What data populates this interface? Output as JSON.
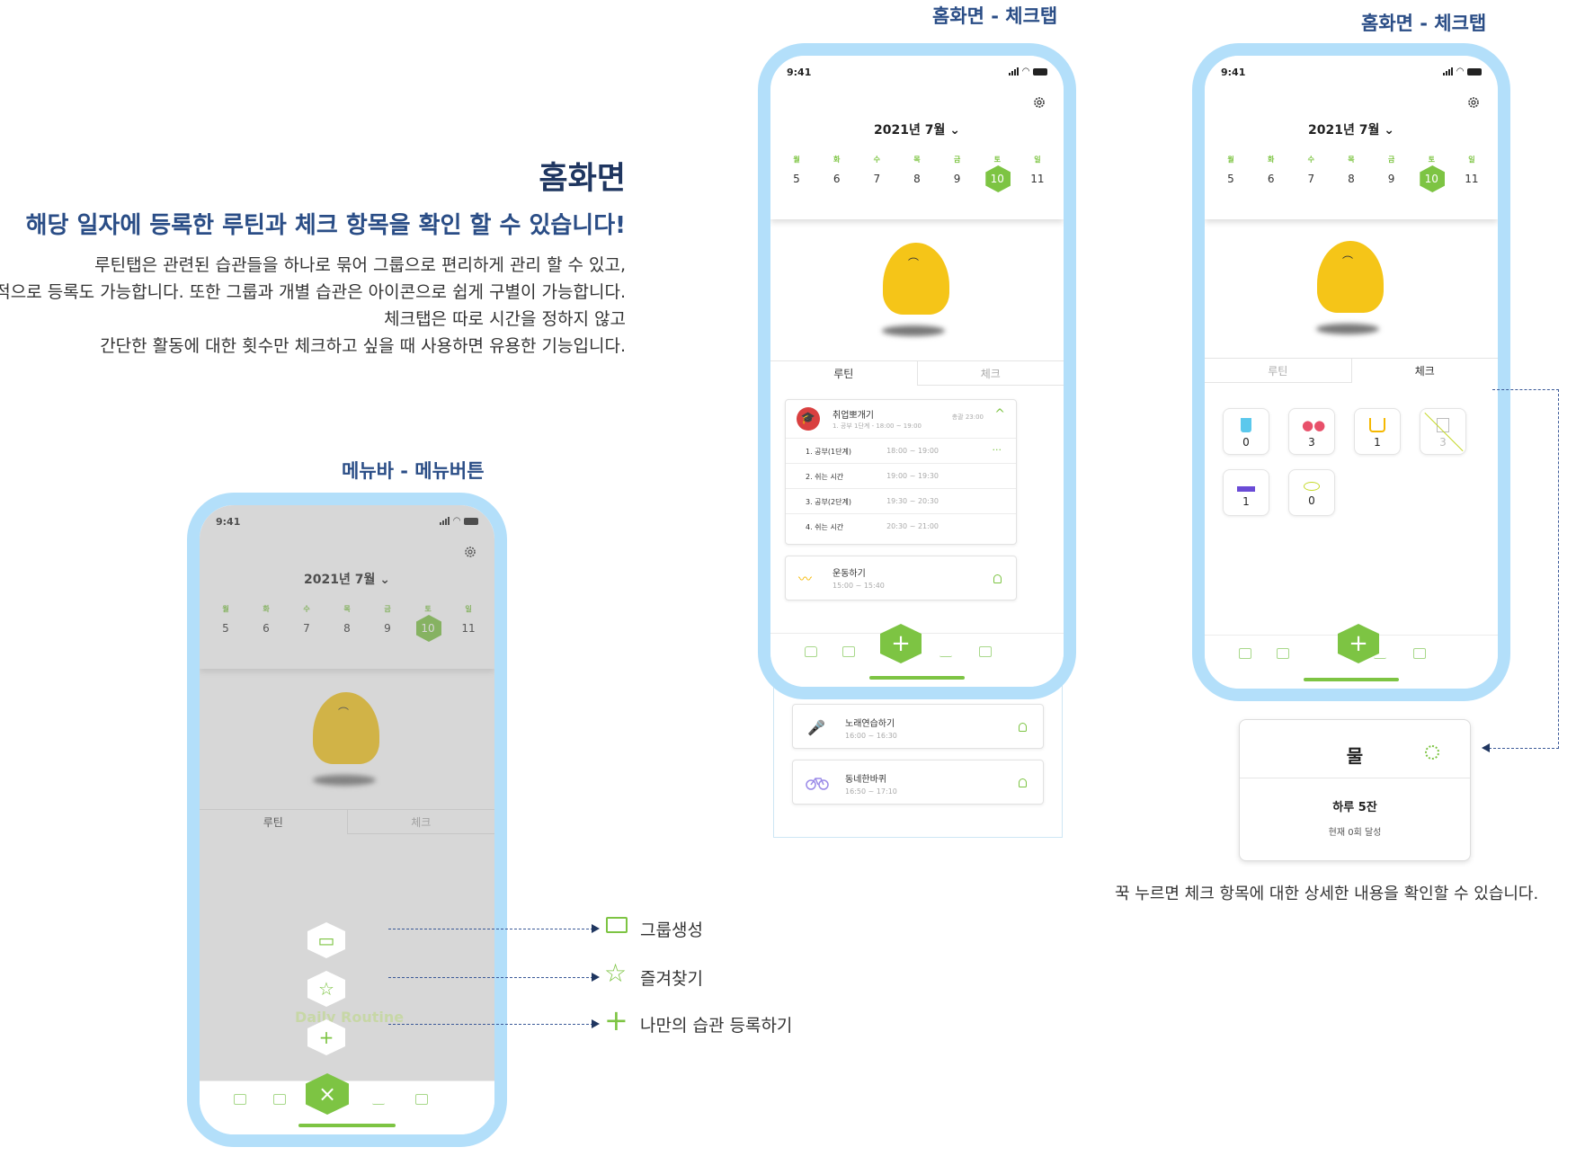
{
  "description": {
    "title": "홈화면",
    "subtitle": "해당 일자에 등록한 루틴과 체크 항목을 확인 할 수 있습니다!",
    "lines": [
      "루틴탭은 관련된 습관들을 하나로 묶어 그룹으로 편리하게 관리 할 수 있고,",
      "개별적으로 등록도 가능합니다. 또한 그룹과 개별 습관은 아이콘으로 쉽게 구별이 가능합니다.",
      "체크탭은 따로 시간을 정하지 않고",
      "간단한 활동에 대한 횟수만 체크하고 싶을 때 사용하면 유용한 기능입니다."
    ]
  },
  "captions": {
    "menu": "메뉴바 - 메뉴버튼",
    "home_routine": "홈화면 - 체크탭",
    "home_check": "홈화면 - 체크탭"
  },
  "phone": {
    "time": "9:41",
    "month": "2021년 7월",
    "weekdays": [
      "월",
      "화",
      "수",
      "목",
      "금",
      "토",
      "일"
    ],
    "dates": [
      "5",
      "6",
      "7",
      "8",
      "9",
      "10",
      "11"
    ],
    "selected_date": "10",
    "tabs": {
      "routine": "루틴",
      "check": "체크"
    },
    "fab_plus": "+",
    "fab_close": "×"
  },
  "routine_tab": {
    "group": {
      "title": "취업뽀개기",
      "subtitle": "1. 공부 1단계 - 18:00 ~ 19:00",
      "right": "총괄 23:00",
      "icon": "graduation-cap-icon"
    },
    "steps": [
      {
        "name": "1. 공부(1단계)",
        "time": "18:00 ~ 19:00"
      },
      {
        "name": "2. 쉬는 시간",
        "time": "19:00 ~ 19:30"
      },
      {
        "name": "3. 공부(2단계)",
        "time": "19:30 ~ 20:30"
      },
      {
        "name": "4. 쉬는 시간",
        "time": "20:30 ~ 21:00"
      }
    ],
    "more": "···",
    "habits": [
      {
        "title": "운동하기",
        "time": "15:00 ~ 15:40",
        "icon": "swim-icon"
      },
      {
        "title": "노래연습하기",
        "time": "16:00 ~ 16:30",
        "icon": "microphone-icon"
      },
      {
        "title": "동네한바퀴",
        "time": "16:50 ~ 17:10",
        "icon": "bicycle-icon"
      }
    ]
  },
  "check_tab": {
    "items": [
      {
        "icon": "water-cup-icon",
        "count": "0",
        "color": "#5bc8ec"
      },
      {
        "icon": "pill-icon",
        "count": "3",
        "color": "#e8506a"
      },
      {
        "icon": "coffee-icon",
        "count": "1",
        "color": "#f5b800"
      },
      {
        "icon": "trash-disabled-icon",
        "count": "3",
        "color": "#bbbbbb"
      },
      {
        "icon": "cigarette-icon",
        "count": "1",
        "color": "#6a4bd6"
      },
      {
        "icon": "eye-icon",
        "count": "0",
        "color": "#c5d92a"
      }
    ]
  },
  "popover": {
    "title": "물",
    "goal": "하루 5잔",
    "status": "현재 0회 달성",
    "caption": "꾹 누르면 체크 항목에 대한 상세한 내용을 확인할 수 있습니다."
  },
  "menu_items": [
    {
      "label": "그룹생성",
      "icon": "folder-icon"
    },
    {
      "label": "즐겨찾기",
      "icon": "star-icon"
    },
    {
      "label": "나만의 습관 등록하기",
      "icon": "plus-icon"
    }
  ],
  "watermark": "Daily Routine",
  "colors": {
    "accent": "#7dc443",
    "frame": "#b3dffa",
    "blob": "#f5c518",
    "heading": "#2a4d86"
  }
}
